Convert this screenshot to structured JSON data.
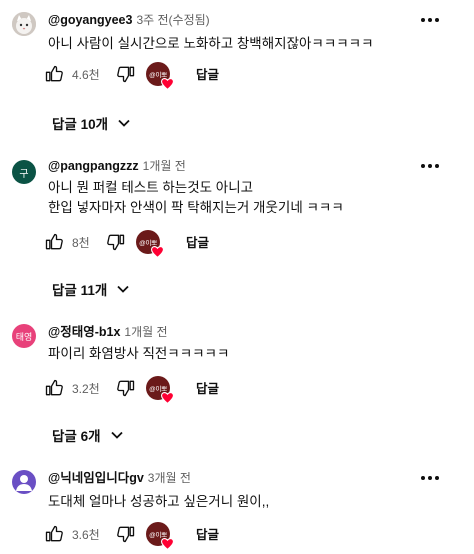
{
  "comments": [
    {
      "author": "@goyangyee3",
      "time": "3주 전(수정됨)",
      "lines": [
        "아니 사람이 실시간으로 노화하고 창백해지잖아ㅋㅋㅋㅋㅋ"
      ],
      "likes": "4.6천",
      "reply_label": "답글",
      "replies": "답글 10개",
      "creator_badge": "@이뽀",
      "avatar": "cat-photo-avatar"
    },
    {
      "author": "@pangpangzzz",
      "time": "1개월 전",
      "lines": [
        "아니 뭔 퍼컬 테스트 하는것도 아니고",
        "한입 넣자마자 안색이 팍 탁해지는거 개웃기네 ㅋㅋㅋ"
      ],
      "likes": "8천",
      "reply_label": "답글",
      "replies": "답글 11개",
      "creator_badge": "@이뽀",
      "avatar_letter": "구"
    },
    {
      "author": "@정태영-b1x",
      "time": "1개월 전",
      "lines": [
        "파이리 화염방사 직전ㅋㅋㅋㅋㅋ"
      ],
      "likes": "3.2천",
      "reply_label": "답글",
      "replies": "답글 6개",
      "creator_badge": "@이뽀",
      "avatar_letter": "태영"
    },
    {
      "author": "@닉네임입니다gv",
      "time": "3개월 전",
      "lines": [
        "도대체 얼마나 성공하고 싶은거니 원이,,"
      ],
      "likes": "3.6천",
      "reply_label": "답글",
      "creator_badge": "@이뽀",
      "avatar": "person-avatar"
    }
  ],
  "colors": {
    "heart": "#ff0033",
    "creator_avatar": "#6b1a1a",
    "avatar_green": "#0b5345",
    "avatar_pink": "#e8417a",
    "avatar_purple": "#6a4fc4"
  }
}
